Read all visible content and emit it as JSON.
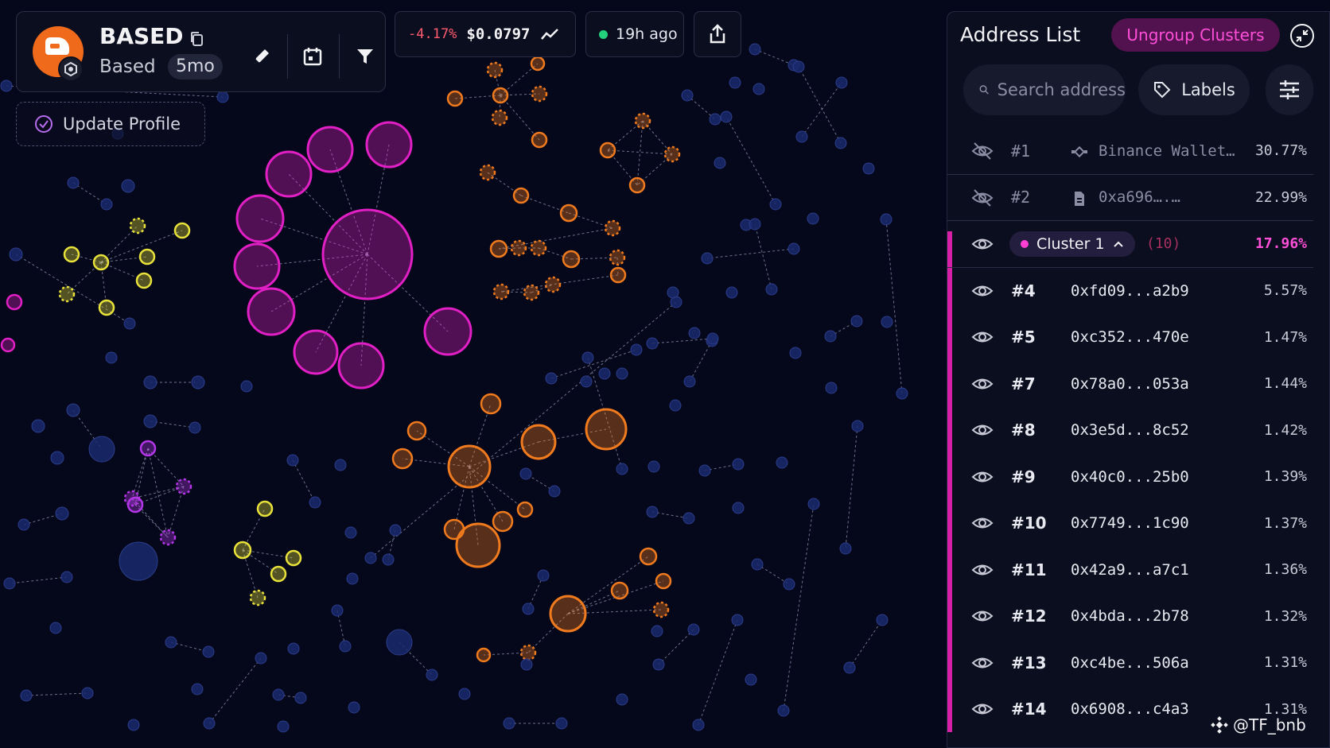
{
  "header": {
    "token_name": "BASED",
    "token_subtitle": "Based",
    "age": "5mo",
    "update_profile_label": "Update Profile"
  },
  "price": {
    "change": "-4.17%",
    "value": "$0.0797"
  },
  "status": {
    "updated": "19h ago"
  },
  "panel": {
    "title": "Address List",
    "ungroup_label": "Ungroup Clusters",
    "search_placeholder": "Search address",
    "labels_button": "Labels"
  },
  "rows_top": [
    {
      "rank": "#1",
      "address": "Binance Wallet…",
      "percent": "30.77%",
      "icon": "binance-icon"
    },
    {
      "rank": "#2",
      "address": "0xa696….…",
      "percent": "22.99%",
      "icon": "contract-icon"
    }
  ],
  "cluster": {
    "label": "Cluster 1",
    "count": "(10)",
    "percent": "17.96%",
    "color": "#ff3fd3"
  },
  "rows": [
    {
      "rank": "#4",
      "address": "0xfd09...a2b9",
      "percent": "5.57%"
    },
    {
      "rank": "#5",
      "address": "0xc352...470e",
      "percent": "1.47%"
    },
    {
      "rank": "#7",
      "address": "0x78a0...053a",
      "percent": "1.44%"
    },
    {
      "rank": "#8",
      "address": "0x3e5d...8c52",
      "percent": "1.42%"
    },
    {
      "rank": "#9",
      "address": "0x40c0...25b0",
      "percent": "1.39%"
    },
    {
      "rank": "#10",
      "address": "0x7749...1c90",
      "percent": "1.37%"
    },
    {
      "rank": "#11",
      "address": "0x42a9...a7c1",
      "percent": "1.36%"
    },
    {
      "rank": "#12",
      "address": "0x4bda...2b78",
      "percent": "1.32%"
    },
    {
      "rank": "#13",
      "address": "0xc4be...506a",
      "percent": "1.31%"
    },
    {
      "rank": "#14",
      "address": "0x6908...c4a3",
      "percent": "1.31%"
    }
  ],
  "watermark": "@TF_bnb",
  "colors": {
    "magenta": "#e01fc4",
    "orange": "#f07a1e",
    "yellow": "#e8e23a",
    "purple": "#b436e8",
    "node_blue": "#1a2a6e",
    "price_down": "#ff5a6e",
    "live": "#23d07b"
  }
}
